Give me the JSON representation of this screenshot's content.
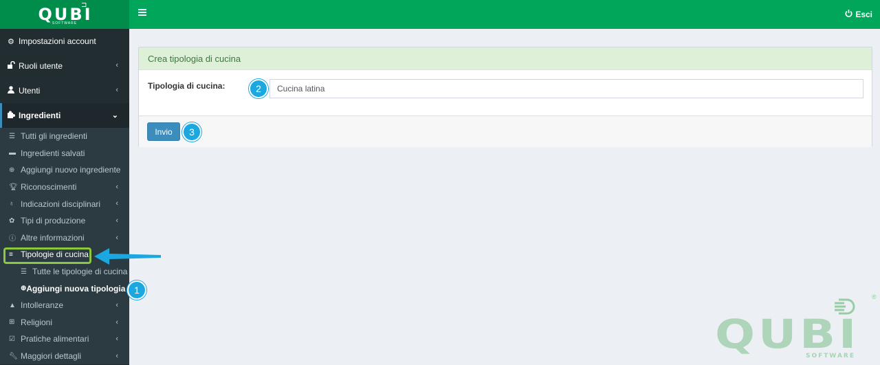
{
  "brand": {
    "logo": "QUBI",
    "logo_sub": "SOFTWARE",
    "colors": {
      "header": "#00a65a",
      "logo_bar": "#008d4c",
      "sidebar": "#222d32",
      "primary": "#3c8dbc",
      "badge": "#1ba8e0",
      "highlight": "#8dc63f"
    }
  },
  "header": {
    "logout_label": "Esci",
    "menu_icon": "hamburger-icon",
    "logout_icon": "power-icon"
  },
  "sidebar": {
    "items": [
      {
        "label": "Impostazioni account",
        "icon": "gear-icon"
      },
      {
        "label": "Ruoli utente",
        "icon": "unlock-icon"
      },
      {
        "label": "Utenti",
        "icon": "user-icon"
      },
      {
        "label": "Ingredienti",
        "icon": "puzzle-icon"
      }
    ],
    "submenu": [
      {
        "label": "Tutti gli ingredienti",
        "icon": "list-icon"
      },
      {
        "label": "Ingredienti salvati",
        "icon": "archive-icon"
      },
      {
        "label": "Aggiungi nuovo ingrediente",
        "icon": "plus-circle-icon"
      },
      {
        "label": "Riconoscimenti",
        "icon": "trophy-icon"
      },
      {
        "label": "Indicazioni disciplinari",
        "icon": "lightbulb-icon"
      },
      {
        "label": "Tipi di produzione",
        "icon": "leaf-icon"
      },
      {
        "label": "Altre informazioni",
        "icon": "info-icon"
      },
      {
        "label": "Tipologie di cucina",
        "icon": "align-left-icon"
      },
      {
        "label": "Tutte le tipologie di cucina",
        "icon": "list-icon"
      },
      {
        "label": "Aggiungi nuova tipologia di",
        "icon": "plus-circle-icon"
      },
      {
        "label": "Intolleranze",
        "icon": "warning-icon"
      },
      {
        "label": "Religioni",
        "icon": "plus-square-icon"
      },
      {
        "label": "Pratiche alimentari",
        "icon": "check-square-icon"
      },
      {
        "label": "Maggiori dettagli",
        "icon": "wrench-icon"
      }
    ]
  },
  "form": {
    "title": "Crea tipologia di cucina",
    "field_label": "Tipologia di cucina:",
    "field_value": "Cucina latina",
    "submit_label": "Invio"
  },
  "steps": [
    "1",
    "2",
    "3"
  ]
}
